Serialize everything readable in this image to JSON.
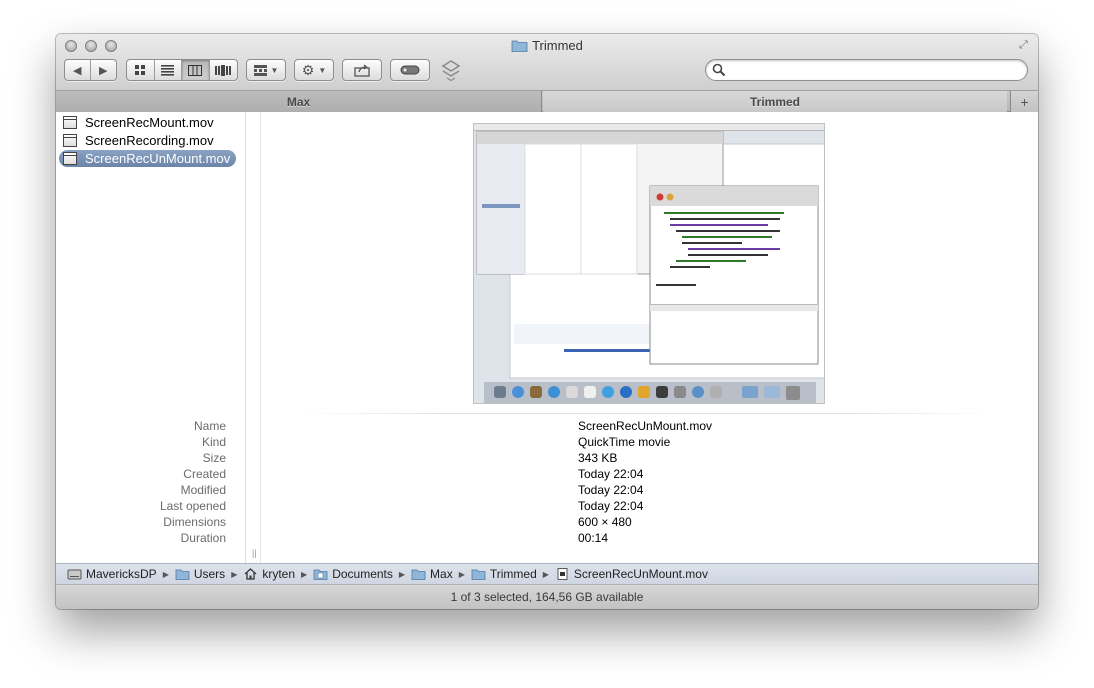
{
  "window": {
    "title": "Trimmed"
  },
  "toolbar": {
    "search": {
      "value": "",
      "placeholder": ""
    }
  },
  "tabs": [
    {
      "label": "Max"
    },
    {
      "label": "Trimmed"
    }
  ],
  "files": [
    {
      "name": "ScreenRecMount.mov",
      "selected": false
    },
    {
      "name": "ScreenRecording.mov",
      "selected": false
    },
    {
      "name": "ScreenRecUnMount.mov",
      "selected": true
    }
  ],
  "info": [
    {
      "label": "Name",
      "value": "ScreenRecUnMount.mov"
    },
    {
      "label": "Kind",
      "value": "QuickTime movie"
    },
    {
      "label": "Size",
      "value": "343 KB"
    },
    {
      "label": "Created",
      "value": "Today 22:04"
    },
    {
      "label": "Modified",
      "value": "Today 22:04"
    },
    {
      "label": "Last opened",
      "value": "Today 22:04"
    },
    {
      "label": "Dimensions",
      "value": "600 × 480"
    },
    {
      "label": "Duration",
      "value": "00:14"
    }
  ],
  "path": [
    {
      "label": "MavericksDP",
      "icon": "hard-drive-icon"
    },
    {
      "label": "Users",
      "icon": "folder-icon"
    },
    {
      "label": "kryten",
      "icon": "home-icon"
    },
    {
      "label": "Documents",
      "icon": "documents-folder-icon"
    },
    {
      "label": "Max",
      "icon": "folder-icon"
    },
    {
      "label": "Trimmed",
      "icon": "folder-icon"
    },
    {
      "label": "ScreenRecUnMount.mov",
      "icon": "movie-file-icon"
    }
  ],
  "status": "1 of 3 selected, 164,56 GB available"
}
